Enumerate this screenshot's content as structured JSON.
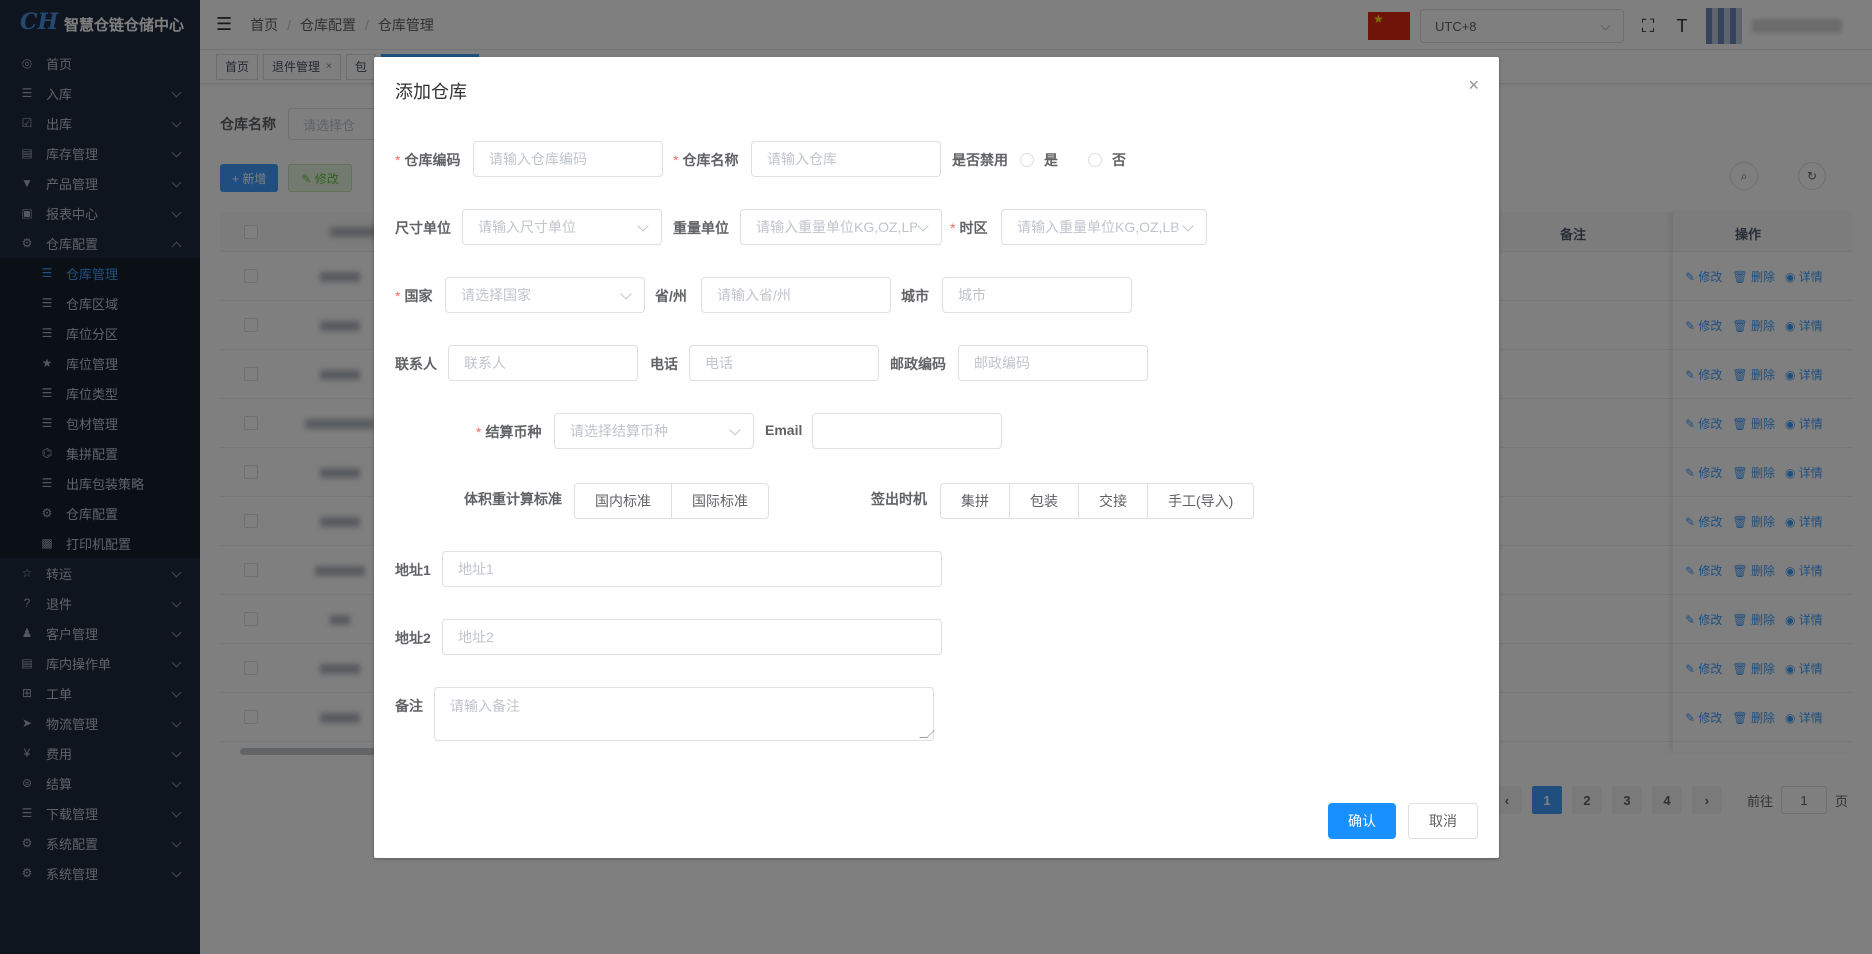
{
  "app": {
    "title": "智慧仓链仓储中心",
    "logo": "CH"
  },
  "sidebar": {
    "items": [
      {
        "label": "首页",
        "icon": "dashboard-icon",
        "glyph": "◎",
        "chevron": false
      },
      {
        "label": "入库",
        "icon": "list-icon",
        "glyph": "☰",
        "chevron": true
      },
      {
        "label": "出库",
        "icon": "checkbox-icon",
        "glyph": "☑",
        "chevron": true
      },
      {
        "label": "库存管理",
        "icon": "inventory-icon",
        "glyph": "▤",
        "chevron": true
      },
      {
        "label": "产品管理",
        "icon": "shirt-icon",
        "glyph": "▼",
        "chevron": true
      },
      {
        "label": "报表中心",
        "icon": "report-icon",
        "glyph": "▣",
        "chevron": true
      },
      {
        "label": "仓库配置",
        "icon": "gear-icon",
        "glyph": "⚙",
        "chevron": true,
        "open": true
      }
    ],
    "submenu": [
      {
        "label": "仓库管理",
        "icon": "list-icon",
        "glyph": "☰",
        "active": true
      },
      {
        "label": "仓库区域",
        "icon": "list-icon",
        "glyph": "☰"
      },
      {
        "label": "库位分区",
        "icon": "list-icon",
        "glyph": "☰"
      },
      {
        "label": "库位管理",
        "icon": "star-icon",
        "glyph": "★"
      },
      {
        "label": "库位类型",
        "icon": "list-icon",
        "glyph": "☰"
      },
      {
        "label": "包材管理",
        "icon": "list-icon",
        "glyph": "☰"
      },
      {
        "label": "集拼配置",
        "icon": "puzzle-icon",
        "glyph": "⌬"
      },
      {
        "label": "出库包装策略",
        "icon": "list-icon",
        "glyph": "☰"
      },
      {
        "label": "仓库配置",
        "icon": "gear-icon",
        "glyph": "⚙"
      },
      {
        "label": "打印机配置",
        "icon": "printer-icon",
        "glyph": "▩"
      }
    ],
    "items_after": [
      {
        "label": "转运",
        "icon": "star-outline-icon",
        "glyph": "☆"
      },
      {
        "label": "退件",
        "icon": "question-icon",
        "glyph": "?"
      },
      {
        "label": "客户管理",
        "icon": "user-icon",
        "glyph": "♟"
      },
      {
        "label": "库内操作单",
        "icon": "document-icon",
        "glyph": "▤"
      },
      {
        "label": "工单",
        "icon": "grid-icon",
        "glyph": "⊞"
      },
      {
        "label": "物流管理",
        "icon": "send-icon",
        "glyph": "➤"
      },
      {
        "label": "费用",
        "icon": "yen-icon",
        "glyph": "¥"
      },
      {
        "label": "结算",
        "icon": "settlement-icon",
        "glyph": "⊜"
      },
      {
        "label": "下载管理",
        "icon": "list-icon",
        "glyph": "☰"
      },
      {
        "label": "系统配置",
        "icon": "gear-icon",
        "glyph": "⚙"
      },
      {
        "label": "系统管理",
        "icon": "gear-icon",
        "glyph": "⚙"
      }
    ]
  },
  "navbar": {
    "breadcrumb": [
      "首页",
      "仓库配置",
      "仓库管理"
    ],
    "timezone": "UTC+8"
  },
  "tags": [
    {
      "label": "首页",
      "closable": false
    },
    {
      "label": "退件管理",
      "closable": true
    },
    {
      "label": "包",
      "closable": false
    },
    {
      "label": "",
      "closable": false,
      "active": true
    }
  ],
  "page": {
    "search_label": "仓库名称",
    "search_placeholder": "请选择仓",
    "add_button": "+ 新增",
    "edit_button": "✎ 修改",
    "col_note": "备注",
    "col_ops": "操作",
    "row_ops": [
      "✎ 修改",
      "🗑 删除",
      "◉ 详情"
    ],
    "pagination": {
      "pages": [
        "1",
        "2",
        "3",
        "4"
      ],
      "current": "1",
      "goto_label": "前往",
      "goto_value": "1",
      "page_suffix": "页"
    }
  },
  "dialog": {
    "title": "添加仓库",
    "fields": {
      "code_label": "仓库编码",
      "code_ph": "请输入仓库编码",
      "name_label": "仓库名称",
      "name_ph": "请输入仓库",
      "disabled_label": "是否禁用",
      "yes": "是",
      "no": "否",
      "size_unit_label": "尺寸单位",
      "size_unit_ph": "请输入尺寸单位",
      "weight_unit_label": "重量单位",
      "weight_unit_ph": "请输入重量单位KG,OZ,LB",
      "tz_label": "时区",
      "tz_ph": "请输入重量单位KG,OZ,LB",
      "country_label": "国家",
      "country_ph": "请选择国家",
      "province_label": "省/州",
      "province_ph": "请输入省/州",
      "city_label": "城市",
      "city_ph": "城市",
      "contact_label": "联系人",
      "contact_ph": "联系人",
      "phone_label": "电话",
      "phone_ph": "电话",
      "zip_label": "邮政编码",
      "zip_ph": "邮政编码",
      "currency_label": "结算币种",
      "currency_ph": "请选择结算币种",
      "email_label": "Email",
      "email_value": "",
      "volume_label": "体积重计算标准",
      "volume_options": [
        "国内标准",
        "国际标准"
      ],
      "signout_label": "签出时机",
      "signout_options": [
        "集拼",
        "包装",
        "交接",
        "手工(导入)"
      ],
      "addr1_label": "地址1",
      "addr1_ph": "地址1",
      "addr2_label": "地址2",
      "addr2_ph": "地址2",
      "remark_label": "备注",
      "remark_ph": "请输入备注"
    },
    "confirm": "确认",
    "cancel": "取消",
    "close": "×"
  }
}
